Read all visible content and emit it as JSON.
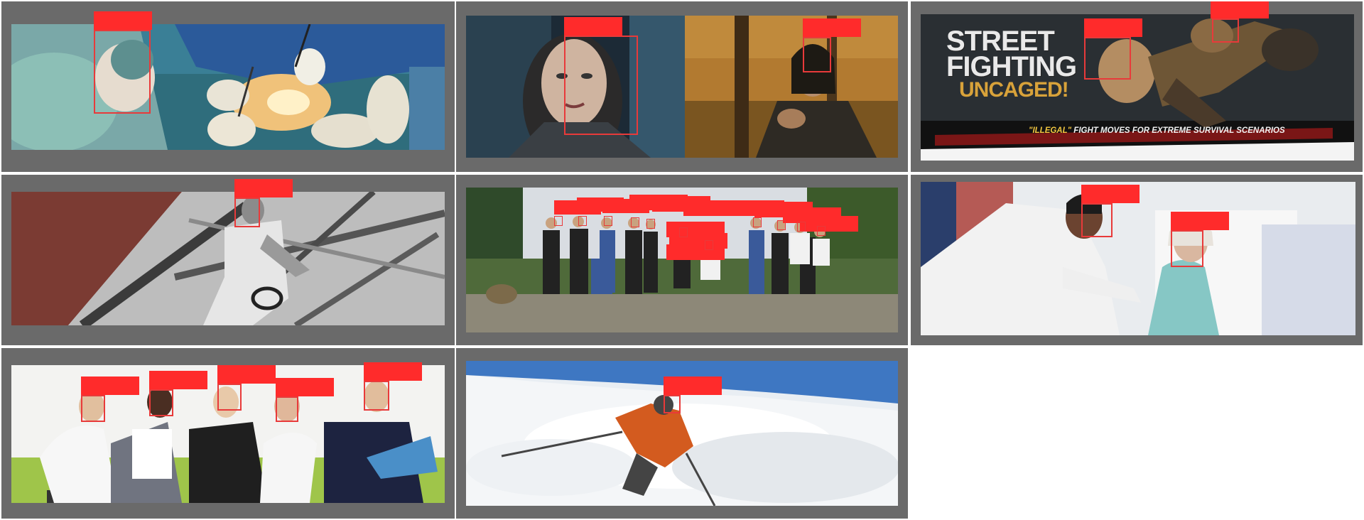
{
  "grid": {
    "background": "#ffffff",
    "tile_color": "#6a6a6a",
    "annotation_color": "#ff2b2b"
  },
  "tiles": [
    {
      "id": "surgery",
      "faces_marked": 1
    },
    {
      "id": "film-stills",
      "faces_marked": 2
    },
    {
      "id": "street-fighting-poster",
      "faces_marked": 2,
      "poster": {
        "title_line1": "STREET",
        "title_line2": "FIGHTING",
        "subtitle": "UNCAGED!",
        "tagline_highlight": "\"ILLEGAL\"",
        "tagline_rest": " FIGHT MOVES FOR EXTREME SURVIVAL SCENARIOS"
      }
    },
    {
      "id": "attic-athlete",
      "faces_marked": 1
    },
    {
      "id": "group-outdoors",
      "faces_marked": 19
    },
    {
      "id": "doctor-patient",
      "faces_marked": 2
    },
    {
      "id": "office-sofa",
      "faces_marked": 5
    },
    {
      "id": "skier",
      "faces_marked": 1
    }
  ]
}
